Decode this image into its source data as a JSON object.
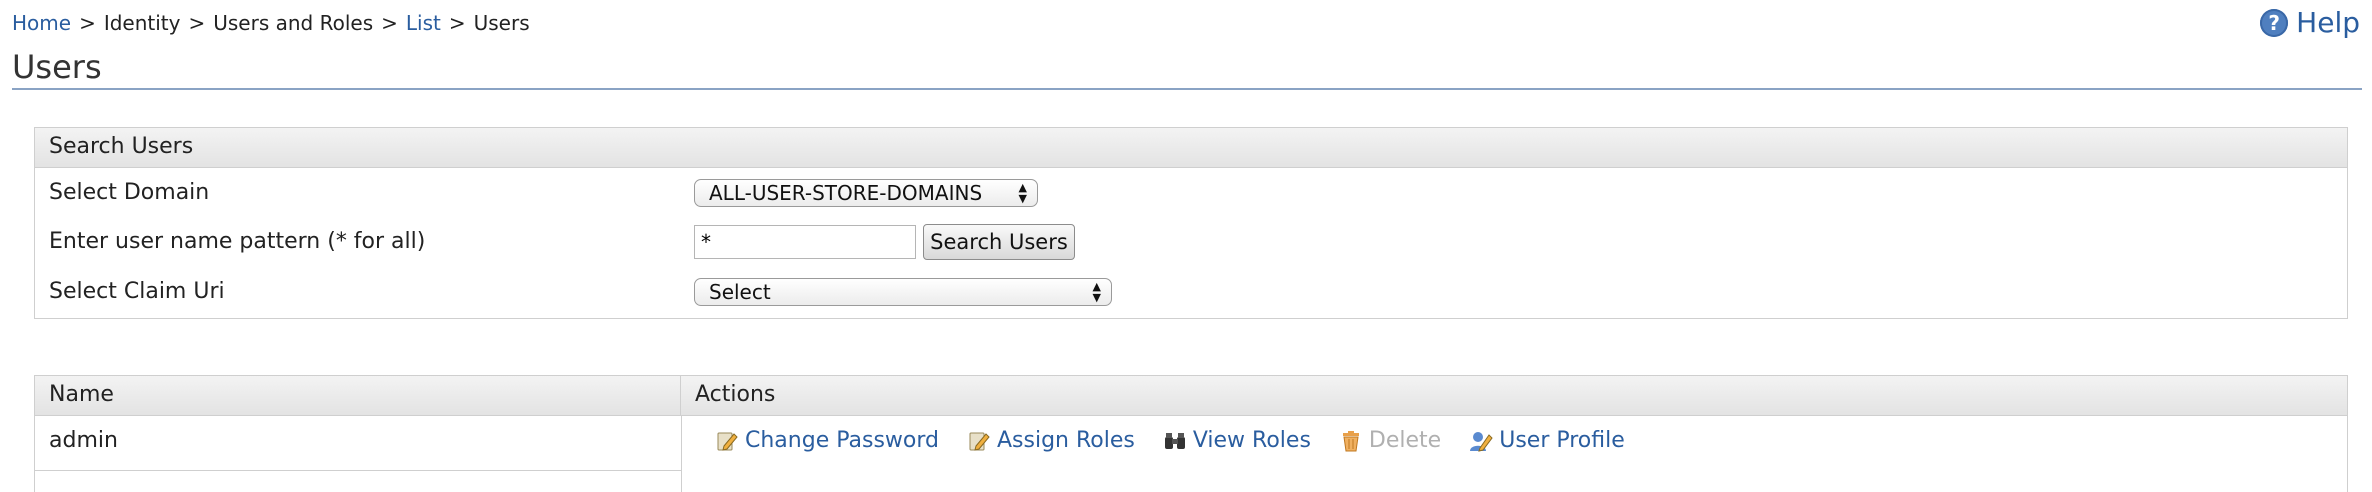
{
  "breadcrumb": {
    "home": "Home",
    "identity": "Identity",
    "users_and_roles": "Users and Roles",
    "list": "List",
    "users": "Users",
    "separator": ">"
  },
  "help": {
    "icon_text": "?",
    "label": "Help"
  },
  "page_title": "Users",
  "search_panel": {
    "header": "Search Users",
    "domain_label": "Select Domain",
    "domain_value": "ALL-USER-STORE-DOMAINS",
    "pattern_label": "Enter user name pattern (* for all)",
    "pattern_value": "*",
    "search_button": "Search Users",
    "claim_label": "Select Claim Uri",
    "claim_value": "Select"
  },
  "users_table": {
    "columns": [
      "Name",
      "Actions"
    ],
    "rows": [
      {
        "name": "admin",
        "actions": [
          {
            "label": "Change Password",
            "icon": "edit-pencil-icon",
            "enabled": true
          },
          {
            "label": "Assign Roles",
            "icon": "edit-pencil-icon",
            "enabled": true
          },
          {
            "label": "View Roles",
            "icon": "binoculars-icon",
            "enabled": true
          },
          {
            "label": "Delete",
            "icon": "trash-icon",
            "enabled": false
          },
          {
            "label": "User Profile",
            "icon": "user-edit-icon",
            "enabled": true
          }
        ]
      }
    ]
  },
  "colors": {
    "link": "#2a5d9f",
    "disabled": "#b0b0b0",
    "header_bg": "#e9e9e9",
    "border": "#cfcfcf",
    "title_rule": "#8aa3c4"
  }
}
